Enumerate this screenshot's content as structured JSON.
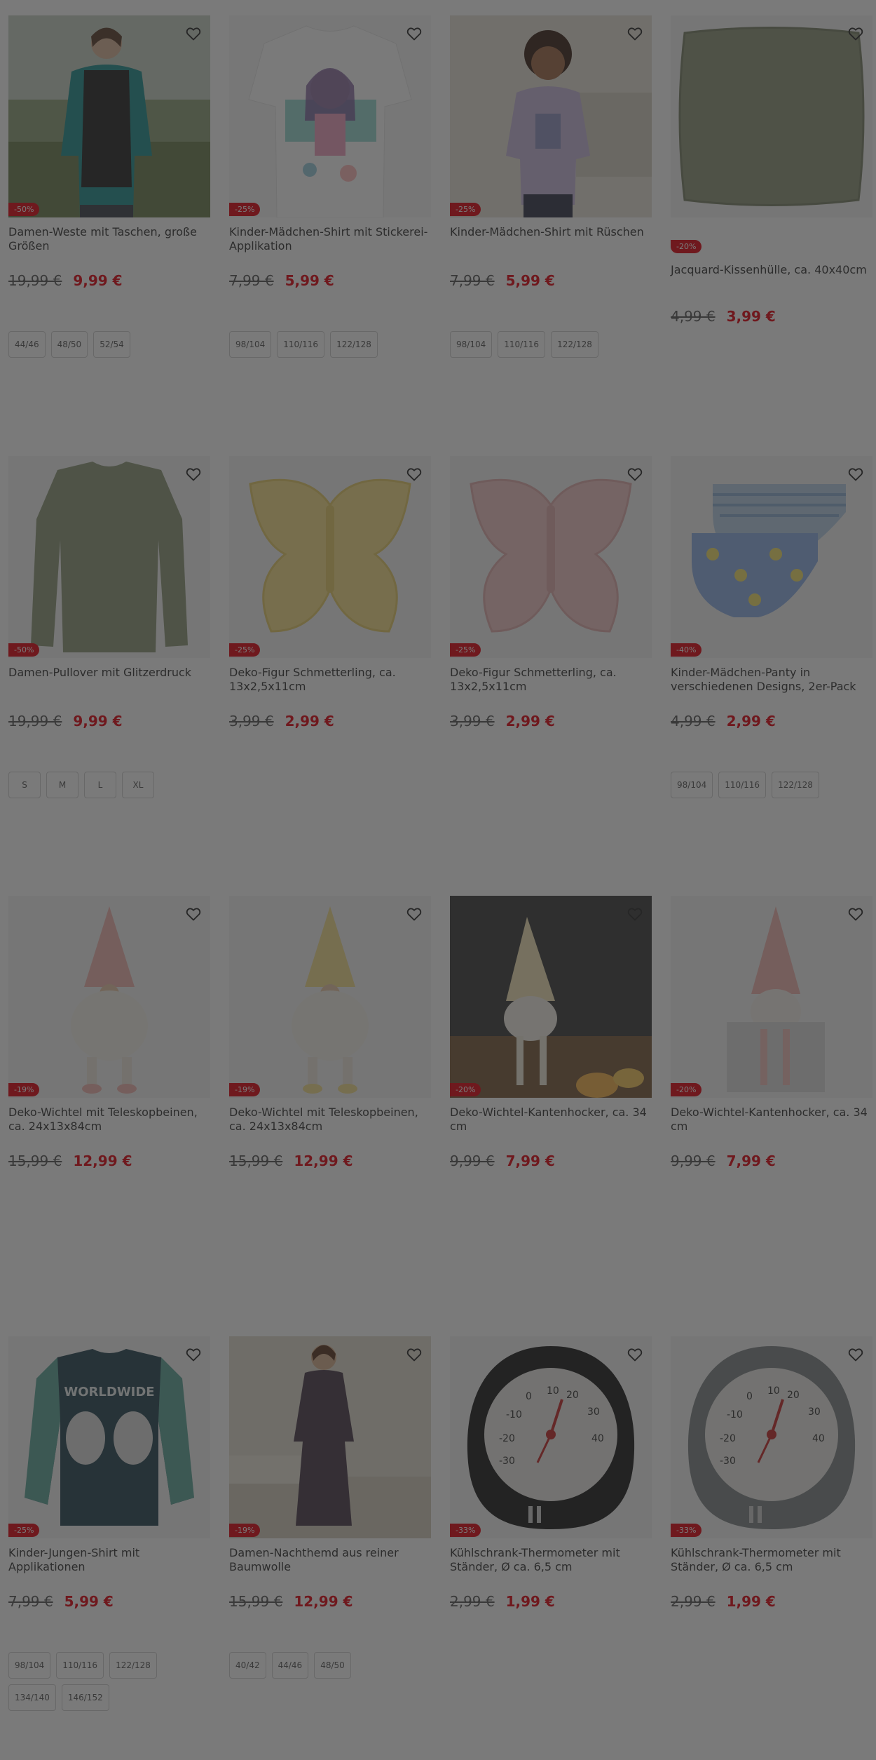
{
  "products": [
    {
      "name": "Damen-Weste mit Taschen, große Größen",
      "discount": "-50%",
      "old_price": "19,99 €",
      "new_price": "9,99 €",
      "sizes": [
        "44/46",
        "48/50",
        "52/54"
      ],
      "image": "woman-vest"
    },
    {
      "name": "Kinder-Mädchen-Shirt mit Stickerei-Applikation",
      "discount": "-25%",
      "old_price": "7,99 €",
      "new_price": "5,99 €",
      "sizes": [
        "98/104",
        "110/116",
        "122/128"
      ],
      "image": "girl-shirt-print"
    },
    {
      "name": "Kinder-Mädchen-Shirt mit Rüschen",
      "discount": "-25%",
      "old_price": "7,99 €",
      "new_price": "5,99 €",
      "sizes": [
        "98/104",
        "110/116",
        "122/128"
      ],
      "image": "girl-model"
    },
    {
      "name": "Jacquard-Kissenhülle, ca. 40x40cm",
      "discount": "-20%",
      "old_price": "4,99 €",
      "new_price": "3,99 €",
      "sizes": [],
      "image": "cushion"
    },
    {
      "name": "Damen-Pullover mit Glitzerdruck",
      "discount": "-50%",
      "old_price": "19,99 €",
      "new_price": "9,99 €",
      "sizes": [
        "S",
        "M",
        "L",
        "XL"
      ],
      "image": "pullover"
    },
    {
      "name": "Deko-Figur Schmetterling, ca. 13x2,5x11cm",
      "discount": "-25%",
      "old_price": "3,99 €",
      "new_price": "2,99 €",
      "sizes": [],
      "image": "butterfly-yellow"
    },
    {
      "name": "Deko-Figur Schmetterling, ca. 13x2,5x11cm",
      "discount": "-25%",
      "old_price": "3,99 €",
      "new_price": "2,99 €",
      "sizes": [],
      "image": "butterfly-pink"
    },
    {
      "name": "Kinder-Mädchen-Panty in verschiedenen Designs, 2er-Pack",
      "discount": "-40%",
      "old_price": "4,99 €",
      "new_price": "2,99 €",
      "sizes": [
        "98/104",
        "110/116",
        "122/128"
      ],
      "image": "panty"
    },
    {
      "name": "Deko-Wichtel mit Teleskopbeinen, ca. 24x13x84cm",
      "discount": "-19%",
      "old_price": "15,99 €",
      "new_price": "12,99 €",
      "sizes": [],
      "image": "gnome-pink"
    },
    {
      "name": "Deko-Wichtel mit Teleskopbeinen, ca. 24x13x84cm",
      "discount": "-19%",
      "old_price": "15,99 €",
      "new_price": "12,99 €",
      "sizes": [],
      "image": "gnome-yellow"
    },
    {
      "name": "Deko-Wichtel-Kantenhocker, ca. 34 cm",
      "discount": "-20%",
      "old_price": "9,99 €",
      "new_price": "7,99 €",
      "sizes": [],
      "image": "gnome-shelf"
    },
    {
      "name": "Deko-Wichtel-Kantenhocker, ca. 34 cm",
      "discount": "-20%",
      "old_price": "9,99 €",
      "new_price": "7,99 €",
      "sizes": [],
      "image": "gnome-sitting"
    },
    {
      "name": "Kinder-Jungen-Shirt mit Applikationen",
      "discount": "-25%",
      "old_price": "7,99 €",
      "new_price": "5,99 €",
      "sizes": [
        "98/104",
        "110/116",
        "122/128",
        "134/140",
        "146/152"
      ],
      "image": "boy-shirt"
    },
    {
      "name": "Damen-Nachthemd aus reiner Baumwolle",
      "discount": "-19%",
      "old_price": "15,99 €",
      "new_price": "12,99 €",
      "sizes": [
        "40/42",
        "44/46",
        "48/50"
      ],
      "image": "nightgown"
    },
    {
      "name": "Kühlschrank-Thermometer mit Ständer, Ø ca. 6,5 cm",
      "discount": "-33%",
      "old_price": "2,99 €",
      "new_price": "1,99 €",
      "sizes": [],
      "image": "thermometer-black"
    },
    {
      "name": "Kühlschrank-Thermometer mit Ständer, Ø ca. 6,5 cm",
      "discount": "-33%",
      "old_price": "2,99 €",
      "new_price": "1,99 €",
      "sizes": [],
      "image": "thermometer-grey"
    }
  ],
  "thermometer_scale": [
    "-10",
    "0",
    "10",
    "20",
    "30",
    "40",
    "-20",
    "-30"
  ],
  "shirt_print": "WORLDWIDE",
  "colors": {
    "sale": "#e3000f",
    "price_new": "#e3000f",
    "overlay": "rgba(40,40,40,0.62)"
  }
}
